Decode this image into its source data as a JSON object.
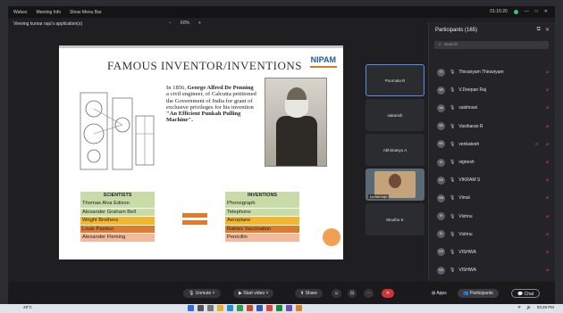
{
  "window": {
    "menu": [
      "Webex",
      "Meeting Info",
      "Show Menu Bar"
    ],
    "time": "01:16:20",
    "viewing": "Viewing kumar raju's application(s)",
    "zoom": "60%"
  },
  "slide": {
    "title": "FAMOUS INVENTOR/INVENTIONS",
    "logo": "NIPAM",
    "para_prefix": "In 1856,",
    "para_name": "George Alfred De Penning",
    "para_mid": "a civil engineer, of Calcutta petitioned the Government of India for grant of exclusive privileges for his invention",
    "para_quote": "\"An Efficient Punkah Pulling Machine\".",
    "scientists_header": "SCIENTISTS",
    "scientists": [
      "Thomas Alva Edison",
      "Alexander Graham Bell",
      "Wright Brothers",
      "Louis Pasteur",
      "Alexander Fleming"
    ],
    "inventions_header": "INVENTIONS",
    "inventions": [
      "Phonograph",
      "Telephone",
      "Aeroplane",
      "Rabies Vaccination",
      "Penicillin"
    ],
    "row_colors": [
      "#c9dba7",
      "#c9dba7",
      "#f2b631",
      "#e07b2d",
      "#f2b99a"
    ]
  },
  "tiles": [
    {
      "name": "Poornala R",
      "active": true
    },
    {
      "name": "sakarish",
      "active": false
    },
    {
      "name": "Abhimanyu A",
      "active": false
    },
    {
      "name": "kumar raju",
      "video": true
    },
    {
      "name": "Mouthu K",
      "active": false
    }
  ],
  "panel": {
    "title": "Participants (165)",
    "search_placeholder": "Search",
    "participants": [
      {
        "initials": "TT",
        "name": "Thiraviyam Thiraviyam"
      },
      {
        "initials": "VR",
        "name": "V.Deepan Raj"
      },
      {
        "initials": "VA",
        "name": "vaishnavi"
      },
      {
        "initials": "VR",
        "name": "Vasiharan R"
      },
      {
        "initials": "VE",
        "name": "venkatesh"
      },
      {
        "initials": "VI",
        "name": "vignesh"
      },
      {
        "initials": "VS",
        "name": "VIKRAM S"
      },
      {
        "initials": "VM",
        "name": "Vimal"
      },
      {
        "initials": "VI",
        "name": "Vishnu"
      },
      {
        "initials": "VI",
        "name": "Vishnu"
      },
      {
        "initials": "VS",
        "name": "VISHWA"
      },
      {
        "initials": "VS",
        "name": "VISHWA"
      }
    ]
  },
  "controls": {
    "unmute": "Unmute",
    "start_video": "Start video",
    "share": "Share",
    "apps": "Apps",
    "participants": "Participants",
    "chat": "Chat"
  },
  "taskbar": {
    "weather": "29°C",
    "time": "03:28 PM"
  }
}
